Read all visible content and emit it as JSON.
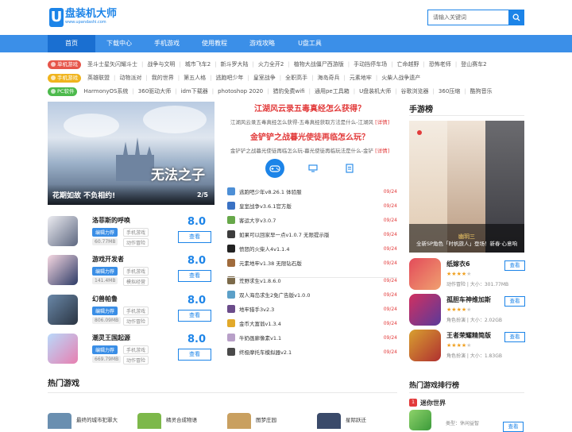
{
  "header": {
    "logo_letter": "U",
    "logo_cn": "盘装机大师",
    "logo_url": "www.upandashi.com",
    "search_placeholder": "请输入关键词"
  },
  "nav": [
    "首页",
    "下载中心",
    "手机游戏",
    "使用教程",
    "游戏攻略",
    "U盘工具"
  ],
  "tag_rows": [
    {
      "tag": "单机游戏",
      "color": "#e6554a",
      "links": [
        "圣斗士星矢闪耀斗士",
        "战争与文明",
        "城市飞车2",
        "新斗罗大陆",
        "火力全开2",
        "植物大战僵尸西游版",
        "手动挡停车场",
        "亡命越野",
        "恐怖老师",
        "登山赛车2"
      ]
    },
    {
      "tag": "手机游戏",
      "color": "#f0b41d",
      "links": [
        "英雄联盟",
        "动物派对",
        "我的世界",
        "第五人格",
        "逃跑吧少年",
        "皇室战争",
        "全职高手",
        "海岛奇兵",
        "元素地牢",
        "火柴人战争遗产"
      ]
    },
    {
      "tag": "PC软件",
      "color": "#4cba4c",
      "links": [
        "HarmonyOS系统",
        "360驱动大师",
        "idm下载器",
        "photoshop 2020",
        "猎豹免费wifi",
        "通用pe工具箱",
        "U盘装机大师",
        "谷歌浏览器",
        "360压缩",
        "酷狗音乐"
      ]
    }
  ],
  "banner": {
    "caption": "花期如故 不负相约!",
    "pager": "2/5",
    "calligraphy": "无法之子"
  },
  "games": [
    {
      "name": "洛菲斯的呼唤",
      "b1": "编辑力荐",
      "b2": "手机游戏",
      "size": "60.77MB",
      "cat": "动作冒险",
      "score": "8.0",
      "dl": "查看",
      "c1": "#ececf1",
      "c2": "#5d6780"
    },
    {
      "name": "游戏开发者",
      "b1": "编辑力荐",
      "b2": "手机游戏",
      "size": "141.4MB",
      "cat": "模拟经营",
      "score": "8.0",
      "dl": "查看",
      "c1": "#f6d8e2",
      "c2": "#2d3b66"
    },
    {
      "name": "幻兽帕鲁",
      "b1": "编辑力荐",
      "b2": "手机游戏",
      "size": "806.09MB",
      "cat": "动作冒险",
      "score": "8.0",
      "dl": "查看",
      "c1": "#6a88a8",
      "c2": "#2a3442"
    },
    {
      "name": "潮灵王国起源",
      "b1": "编辑力荐",
      "b2": "手机游戏",
      "size": "669.79MB",
      "cat": "动作冒险",
      "score": "8.0",
      "dl": "查看",
      "c1": "#b9d9fb",
      "c2": "#e77fb0"
    }
  ],
  "headlines": [
    {
      "title": "江湖风云录五毒真经怎么获得？",
      "desc": "江湖风云录五毒真经怎么获得-五毒真经获取方法是什么-江湖风",
      "more": "[详情]"
    },
    {
      "title": "金铲铲之战暮光使徒再临怎么玩？",
      "desc": "金铲铲之战暮光使徒再临怎么玩-暮光使徒再临玩法是什么-金铲",
      "more": "[详情]"
    }
  ],
  "tab_icons": [
    "gamepad-icon",
    "monitor-icon",
    "document-icon"
  ],
  "list": [
    {
      "name": "逃跑吧少年v8.26.1 体验服",
      "date": "09/24",
      "color": "#4d8fd6"
    },
    {
      "name": "皇室战争v3.6.1官方版",
      "date": "09/24",
      "color": "#3a72c4"
    },
    {
      "name": "客运大亨v3.0.7",
      "date": "09/24",
      "color": "#67a84a"
    },
    {
      "name": "如果可以回家早一点v1.0.7 无限提示版",
      "date": "09/24",
      "color": "#3c3c3c"
    },
    {
      "name": "愤怒的火柴人4v1.1.4",
      "date": "09/24",
      "color": "#222222"
    },
    {
      "name": "元素地牢v1.38 无限钻石版",
      "date": "09/24",
      "color": "#a06b3c"
    },
    {
      "name": "荒野求生v1.8.6.0",
      "date": "09/24",
      "color": "#7c6a4a"
    },
    {
      "name": "双人海岛求生2免广告版v1.0.0",
      "date": "09/24",
      "color": "#5ca0c8"
    },
    {
      "name": "地牢猎手3v2.3",
      "date": "09/24",
      "color": "#6b4c8a"
    },
    {
      "name": "金币大富翁v1.3.4",
      "date": "09/24",
      "color": "#e2a92a"
    },
    {
      "name": "牛奶画廊像素v1.1",
      "date": "09/24",
      "color": "#b8a0c8"
    },
    {
      "name": "终极摩托车模拟器v2.1",
      "date": "09/24",
      "color": "#4a4a4a"
    }
  ],
  "side": {
    "title": "手游榜",
    "ad_caption_1": "幽玥三",
    "ad_caption_2": "全新SP角色「时帆旅人」登场！新春·心意响",
    "ad_caption_3": "",
    "games": [
      {
        "name": "纸嫁衣6",
        "stars": 4,
        "meta": "动作冒险 | 大小：301.77MB",
        "dl": "查看",
        "c1": "#e34b5a",
        "c2": "#f0a070"
      },
      {
        "name": "孤胆车神维加斯",
        "stars": 4,
        "meta": "角色扮演 | 大小：2.02GB",
        "dl": "查看",
        "c1": "#d13060",
        "c2": "#5b3a9a"
      },
      {
        "name": "王者荣耀精简版",
        "stars": 4,
        "meta": "角色扮演 | 大小：1.83GB",
        "dl": "查看",
        "c1": "#d8a030",
        "c2": "#b03030"
      }
    ]
  },
  "sections": {
    "hot_games": "热门游戏",
    "hot_rank": "热门游戏排行榜"
  },
  "hot_games": [
    {
      "name": "最终的城市犯罪大",
      "c": "#6a8fb0"
    },
    {
      "name": "精灵合成物语",
      "c": "#7db84a"
    },
    {
      "name": "图梦庄园",
      "c": "#c9a060"
    },
    {
      "name": "星际跃迁",
      "c": "#3a4a6a"
    }
  ],
  "rank_first": {
    "name": "迷你世界",
    "meta": "类型：休闲益智",
    "dl": "查看"
  }
}
